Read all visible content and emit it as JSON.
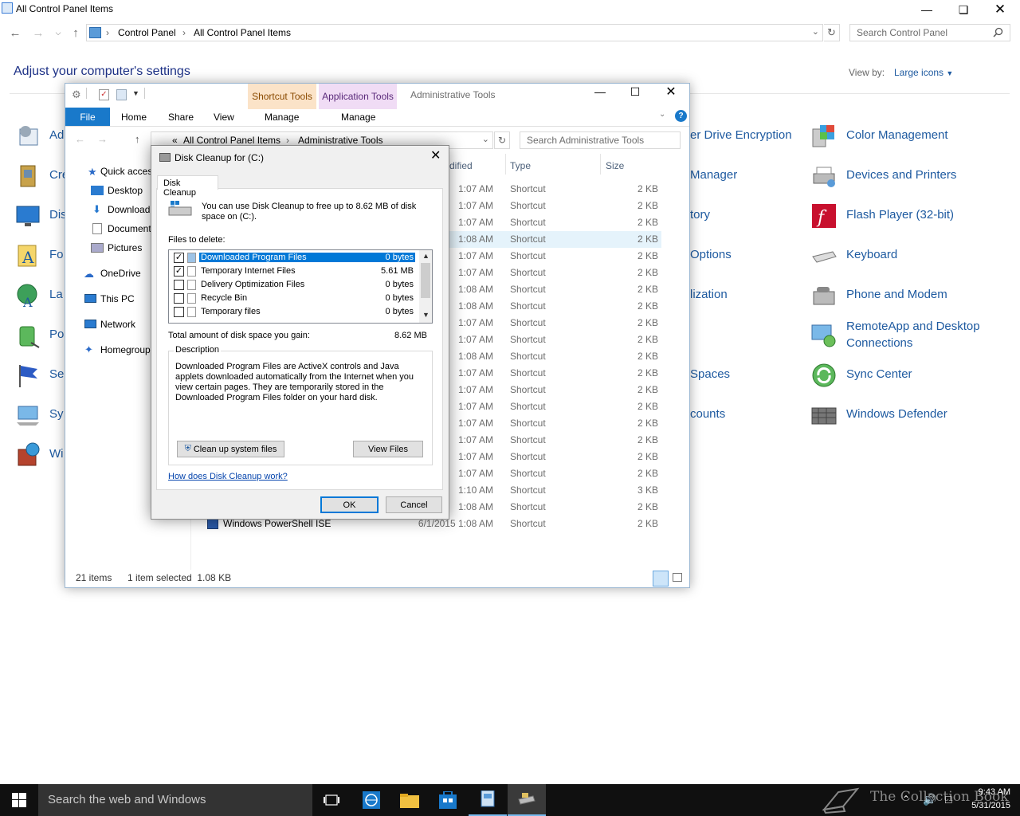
{
  "control_panel": {
    "window_title": "All Control Panel Items",
    "breadcrumbs": [
      "Control Panel",
      "All Control Panel Items"
    ],
    "search_placeholder": "Search Control Panel",
    "heading": "Adjust your computer's settings",
    "view_by_label": "View by:",
    "view_by_value": "Large icons",
    "left_items": [
      "Ad",
      "Cre",
      "Dis",
      "Fo",
      "La",
      "Po",
      "Se",
      "Sy",
      "Wi"
    ],
    "middle_items": [
      "er Drive Encryption",
      "Manager",
      "tory",
      "Options",
      "lization",
      "Spaces",
      "counts"
    ],
    "right_items": [
      "Color Management",
      "Devices and Printers",
      "Flash Player (32-bit)",
      "Keyboard",
      "Phone and Modem",
      "RemoteApp and Desktop",
      "Connections",
      "Sync Center",
      "Windows Defender"
    ]
  },
  "explorer": {
    "ribbon_tabs": {
      "file": "File",
      "home": "Home",
      "share": "Share",
      "view": "View"
    },
    "shortcut_tools": "Shortcut Tools",
    "application_tools": "Application Tools",
    "manage": "Manage",
    "title": "Administrative Tools",
    "breadcrumbs": [
      "«",
      "All Control Panel Items",
      "Administrative Tools"
    ],
    "search_placeholder": "Search Administrative Tools",
    "columns": {
      "modified": "dified",
      "type": "Type",
      "size": "Size"
    },
    "sidebar": [
      "Quick acces",
      "Desktop",
      "Download",
      "Document",
      "Pictures",
      "OneDrive",
      "This PC",
      "Network",
      "Homegroup"
    ],
    "rows": [
      {
        "time": "1:07 AM",
        "type": "Shortcut",
        "size": "2 KB"
      },
      {
        "time": "1:07 AM",
        "type": "Shortcut",
        "size": "2 KB"
      },
      {
        "time": "1:07 AM",
        "type": "Shortcut",
        "size": "2 KB"
      },
      {
        "time": "1:08 AM",
        "type": "Shortcut",
        "size": "2 KB"
      },
      {
        "time": "1:07 AM",
        "type": "Shortcut",
        "size": "2 KB"
      },
      {
        "time": "1:07 AM",
        "type": "Shortcut",
        "size": "2 KB"
      },
      {
        "time": "1:08 AM",
        "type": "Shortcut",
        "size": "2 KB"
      },
      {
        "time": "1:08 AM",
        "type": "Shortcut",
        "size": "2 KB"
      },
      {
        "time": "1:07 AM",
        "type": "Shortcut",
        "size": "2 KB"
      },
      {
        "time": "1:07 AM",
        "type": "Shortcut",
        "size": "2 KB"
      },
      {
        "time": "1:08 AM",
        "type": "Shortcut",
        "size": "2 KB"
      },
      {
        "time": "1:07 AM",
        "type": "Shortcut",
        "size": "2 KB"
      },
      {
        "time": "1:07 AM",
        "type": "Shortcut",
        "size": "2 KB"
      },
      {
        "time": "1:07 AM",
        "type": "Shortcut",
        "size": "2 KB"
      },
      {
        "time": "1:07 AM",
        "type": "Shortcut",
        "size": "2 KB"
      },
      {
        "time": "1:07 AM",
        "type": "Shortcut",
        "size": "2 KB"
      },
      {
        "time": "1:07 AM",
        "type": "Shortcut",
        "size": "2 KB"
      },
      {
        "time": "1:07 AM",
        "type": "Shortcut",
        "size": "2 KB"
      },
      {
        "time": "1:10 AM",
        "type": "Shortcut",
        "size": "3 KB"
      },
      {
        "time": "1:08 AM",
        "type": "Shortcut",
        "size": "2 KB"
      },
      {
        "name": "Windows PowerShell ISE",
        "time": "6/1/2015 1:08 AM",
        "type": "Shortcut",
        "size": "2 KB"
      }
    ],
    "status_items": "21 items",
    "status_selected": "1 item selected  1.08 KB"
  },
  "disk_cleanup": {
    "title": "Disk Cleanup for  (C:)",
    "tab": "Disk Cleanup",
    "intro": "You can use Disk Cleanup to free up to 8.62 MB of disk space on  (C:).",
    "files_label": "Files to delete:",
    "files": [
      {
        "name": "Downloaded Program Files",
        "size": "0 bytes",
        "checked": true
      },
      {
        "name": "Temporary Internet Files",
        "size": "5.61 MB",
        "checked": true
      },
      {
        "name": "Delivery Optimization Files",
        "size": "0 bytes",
        "checked": false
      },
      {
        "name": "Recycle Bin",
        "size": "0 bytes",
        "checked": false
      },
      {
        "name": "Temporary files",
        "size": "0 bytes",
        "checked": false
      }
    ],
    "total_label": "Total amount of disk space you gain:",
    "total_value": "8.62 MB",
    "description_label": "Description",
    "description": "Downloaded Program Files are ActiveX controls and Java applets downloaded automatically from the Internet when you view certain pages. They are temporarily stored in the Downloaded Program Files folder on your hard disk.",
    "cleanup_system": "Clean up system files",
    "view_files": "View Files",
    "help_link": "How does Disk Cleanup work?",
    "ok": "OK",
    "cancel": "Cancel"
  },
  "taskbar": {
    "search": "Search the web and Windows",
    "time": "9:43 AM",
    "date": "5/31/2015",
    "watermark": "The Collection Book"
  }
}
